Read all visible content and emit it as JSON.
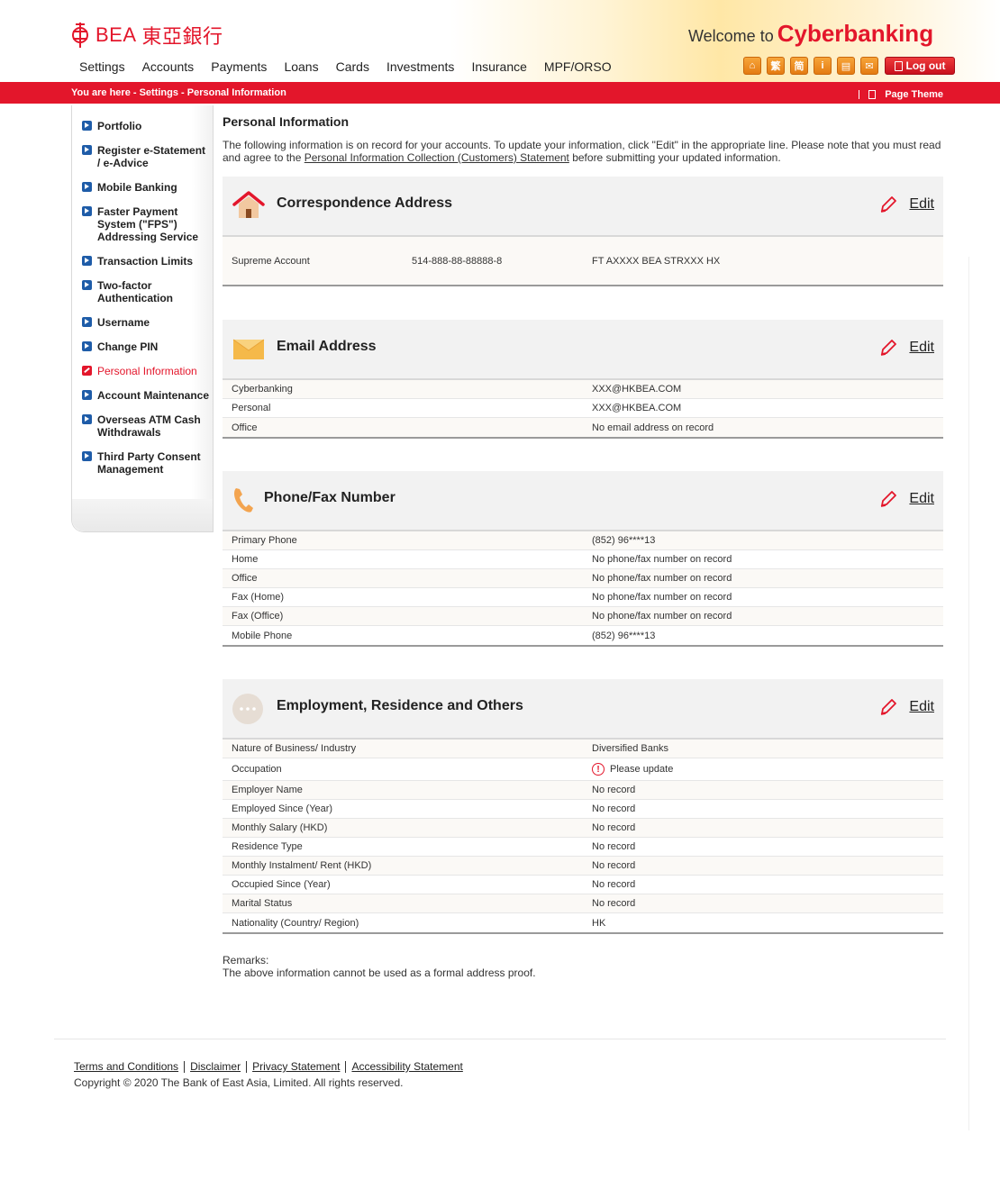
{
  "header": {
    "logo_text": "BEA",
    "logo_cn": "東亞銀行",
    "welcome_prefix": "Welcome to",
    "welcome_brand": "Cyberbanking",
    "nav": [
      "Settings",
      "Accounts",
      "Payments",
      "Loans",
      "Cards",
      "Investments",
      "Insurance",
      "MPF/ORSO"
    ],
    "tool_icons": [
      {
        "name": "home-icon",
        "glyph": "⌂"
      },
      {
        "name": "traditional-chinese-icon",
        "glyph": "繁"
      },
      {
        "name": "simplified-chinese-icon",
        "glyph": "简"
      },
      {
        "name": "info-icon",
        "glyph": "i"
      },
      {
        "name": "print-icon",
        "glyph": "▤"
      },
      {
        "name": "mail-icon",
        "glyph": "✉"
      }
    ],
    "logout_label": "Log out"
  },
  "breadcrumb": "You are here - Settings - Personal Information",
  "page_theme_label": "Page Theme",
  "sidebar": {
    "items": [
      {
        "label": "Portfolio"
      },
      {
        "label": "Register e-Statement / e-Advice"
      },
      {
        "label": "Mobile Banking"
      },
      {
        "label": "Faster Payment System (\"FPS\") Addressing Service"
      },
      {
        "label": "Transaction Limits"
      },
      {
        "label": "Two-factor Authentication"
      },
      {
        "label": "Username"
      },
      {
        "label": "Change PIN"
      },
      {
        "label": "Personal Information"
      },
      {
        "label": "Account Maintenance"
      },
      {
        "label": "Overseas ATM Cash Withdrawals"
      },
      {
        "label": "Third Party Consent Management"
      }
    ]
  },
  "main": {
    "title": "Personal Information",
    "intro_1": "The following information is on record for your accounts. To update your information, click \"Edit\" in the appropriate line. Please note that you must read and agree to the ",
    "intro_link": "Personal Information Collection (Customers) Statement",
    "intro_2": " before submitting your updated information.",
    "edit_label": "Edit",
    "correspondence": {
      "title": "Correspondence Address",
      "account_type": "Supreme Account",
      "account_number": "514-888-88-88888-8",
      "address": "FT AXXXX BEA STRXXX HX"
    },
    "email": {
      "title": "Email Address",
      "rows": [
        {
          "k": "Cyberbanking",
          "v": "XXX@HKBEA.COM"
        },
        {
          "k": "Personal",
          "v": "XXX@HKBEA.COM"
        },
        {
          "k": "Office",
          "v": "No email address on record"
        }
      ]
    },
    "phone": {
      "title": "Phone/Fax Number",
      "rows": [
        {
          "k": "Primary Phone",
          "v": "(852)  96****13"
        },
        {
          "k": "Home",
          "v": "No phone/fax number on record"
        },
        {
          "k": "Office",
          "v": "No phone/fax number on record"
        },
        {
          "k": "Fax (Home)",
          "v": "No phone/fax number on record"
        },
        {
          "k": "Fax (Office)",
          "v": "No phone/fax number on record"
        },
        {
          "k": "Mobile Phone",
          "v": "(852)  96****13"
        }
      ]
    },
    "employment": {
      "title": "Employment, Residence and Others",
      "rows": [
        {
          "k": "Nature of Business/ Industry",
          "v": "Diversified Banks"
        },
        {
          "k": "Occupation",
          "v": "Please update"
        },
        {
          "k": "Employer Name",
          "v": "No record"
        },
        {
          "k": "Employed Since (Year)",
          "v": "No record"
        },
        {
          "k": "Monthly Salary (HKD)",
          "v": "No record"
        },
        {
          "k": "Residence Type",
          "v": "No record"
        },
        {
          "k": "Monthly Instalment/ Rent (HKD)",
          "v": "No record"
        },
        {
          "k": "Occupied Since (Year)",
          "v": "No record"
        },
        {
          "k": "Marital Status",
          "v": "No record"
        },
        {
          "k": "Nationality (Country/ Region)",
          "v": "HK"
        }
      ]
    },
    "remarks_label": "Remarks:",
    "remarks_text": "The above information cannot be used as a formal address proof."
  },
  "footer": {
    "links": [
      "Terms and Conditions",
      "Disclaimer",
      "Privacy Statement",
      "Accessibility Statement"
    ],
    "copyright": "Copyright © 2020 The Bank of East Asia, Limited. All rights reserved."
  },
  "colors": {
    "brand_red": "#e3162b",
    "bullet_blue": "#1e5ca8",
    "icon_orange": "#f09a2e"
  }
}
